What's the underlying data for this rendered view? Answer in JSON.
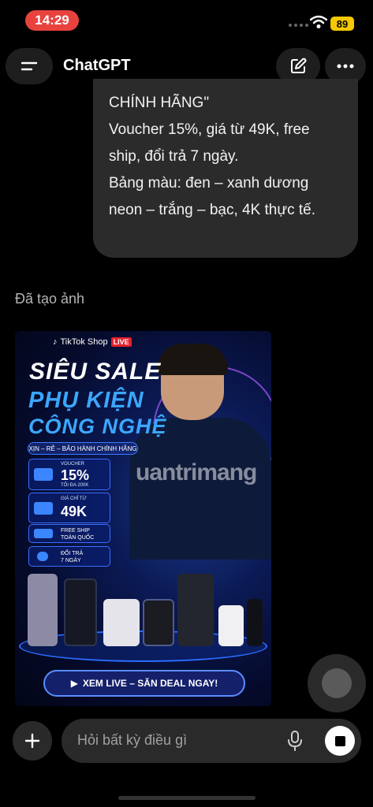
{
  "status_bar": {
    "time": "14:29",
    "battery": "89"
  },
  "header": {
    "title": "ChatGPT",
    "menu_icon": "menu-icon",
    "edit_icon": "compose-icon",
    "more_icon": "more-icon"
  },
  "conversation": {
    "user_message_lines": [
      "CHÍNH HÃNG\"",
      "Voucher 15%, giá từ 49K, free",
      "ship, đổi trả 7 ngày.",
      "Bảng màu: đen – xanh dương",
      "neon – trắng – bạc, 4K thực tế."
    ],
    "assistant_label": "Đã tạo ảnh"
  },
  "poster": {
    "brand": "TikTok Shop",
    "live": "LIVE",
    "title_line1": "SIÊU SALE",
    "title_line2": "PHỤ KIỆN",
    "title_line3": "CÔNG NGHỆ",
    "tagline": "XỊN – RẺ – BẢO HÀNH CHÍNH HÃNG",
    "voucher_label": "VOUCHER",
    "voucher_value": "15%",
    "voucher_note": "TỐI ĐA 200K",
    "price_label": "GIÁ CHỈ TỪ",
    "price_value": "49K",
    "ship_line1": "FREE SHIP",
    "ship_line2": "TOÀN QUỐC",
    "return_line1": "ĐỔI TRẢ",
    "return_line2": "7 NGÀY",
    "cta": "XEM LIVE – SĂN DEAL NGAY!",
    "watermark": "uantrimang"
  },
  "composer": {
    "placeholder": "Hỏi bất kỳ điều gì",
    "add_icon": "plus-icon",
    "mic_icon": "microphone-icon",
    "stop_icon": "stop-icon"
  },
  "colors": {
    "background": "#000000",
    "bubble": "#2b2b2b",
    "time_pill": "#e8423f",
    "battery": "#f6c800",
    "poster_accent": "#3ba7ff"
  }
}
